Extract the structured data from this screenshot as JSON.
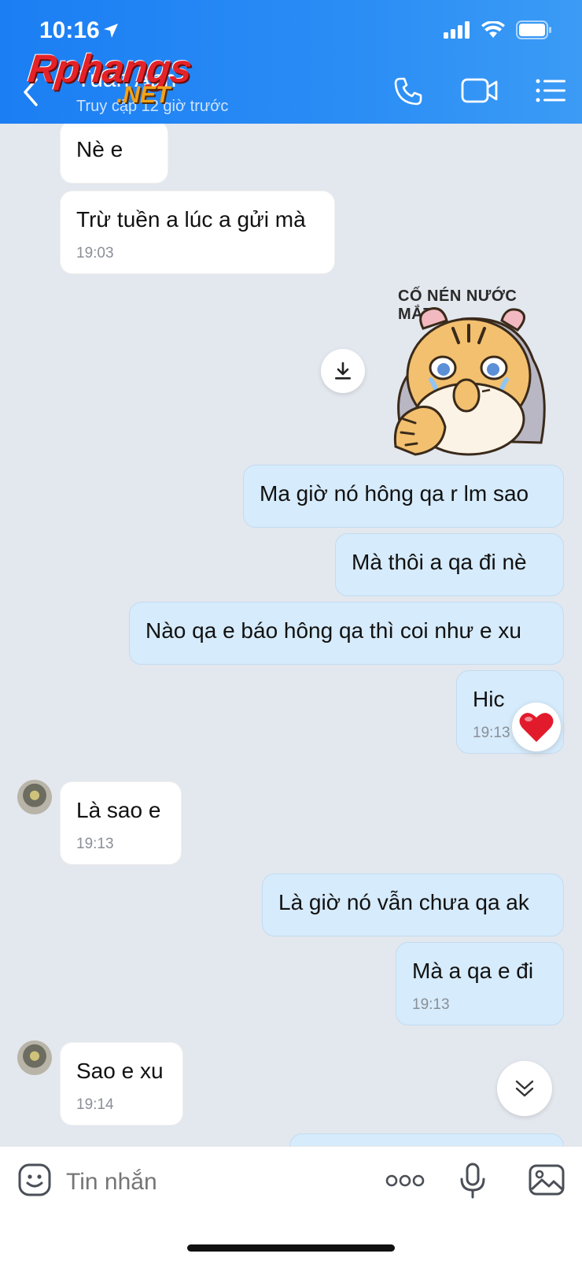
{
  "status_bar": {
    "time": "10:16"
  },
  "header": {
    "contact_name": "Tuấn Anh",
    "contact_status": "Truy cập 12 giờ trước",
    "watermark_main": "Rphangs",
    "watermark_net": ".NET"
  },
  "messages": [
    {
      "text": "Nè e",
      "time": ""
    },
    {
      "text": "Trừ tuền a lúc a gửi mà",
      "time": "19:03"
    },
    {
      "text": "Ma giờ nó hông qa r lm sao",
      "time": ""
    },
    {
      "text": "Mà thôi a qa đi nè",
      "time": ""
    },
    {
      "text": "Nào qa e báo hông qa thì coi như e xu",
      "time": ""
    },
    {
      "text": "Hic",
      "time": "19:13"
    },
    {
      "text": "Là sao e",
      "time": "19:13"
    },
    {
      "text": "Là giờ nó vẫn chưa qa ak",
      "time": ""
    },
    {
      "text": "Mà a qa e đi",
      "time": "19:13"
    },
    {
      "text": "Sao e xu",
      "time": "19:14"
    }
  ],
  "sticker": {
    "caption": "CỐ NÉN NƯỚC MẮT"
  },
  "composer": {
    "placeholder": "Tin nhắn"
  },
  "colors": {
    "header": "#1b7ef3",
    "outgoing": "#d6ebfb",
    "incoming": "#ffffff",
    "background": "#e3e7ee"
  },
  "icons": [
    "location-arrow-icon",
    "signal-icon",
    "wifi-icon",
    "battery-icon",
    "back-chevron-icon",
    "phone-icon",
    "video-icon",
    "menu-list-icon",
    "download-icon",
    "heart-icon",
    "chevron-double-down-icon",
    "emoji-icon",
    "more-icon",
    "microphone-icon",
    "image-icon"
  ]
}
